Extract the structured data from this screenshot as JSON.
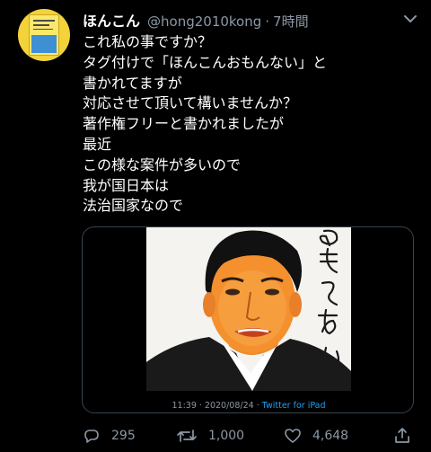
{
  "tweet": {
    "name": "ほんこん",
    "handle": "@hong2010kong",
    "separator": "·",
    "time": "7時間",
    "lines": [
      "これ私の事ですか？",
      "タグ付けで「ほんこんおもんない」と",
      "書かれてますが",
      "対応させて頂いて構いませんか？",
      "著作権フリーと書かれましたが",
      "最近",
      "この様な案件が多いので",
      "我が国日本は",
      "法治国家なので"
    ]
  },
  "media": {
    "handwritten_text": "おもろない",
    "meta_time": "11:39 · 2020/08/24 · ",
    "meta_source": "Twitter for iPad"
  },
  "actions": {
    "reply_count": "295",
    "retweet_count": "1,000",
    "like_count": "4,648"
  },
  "colors": {
    "background": "#000000",
    "text_primary": "#ffffff",
    "text_secondary": "#8b98a5",
    "accent": "#1da1f2",
    "border": "#38444d"
  }
}
